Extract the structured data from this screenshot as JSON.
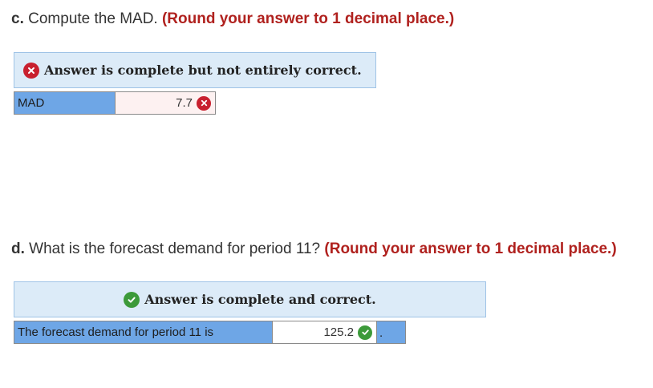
{
  "part_c": {
    "letter": "c.",
    "question": " Compute the MAD. ",
    "instruction": "(Round your answer to 1 decimal place.)",
    "banner": {
      "status": "incorrect",
      "icon": "x-circle-icon",
      "text": "Answer is complete but not entirely correct."
    },
    "answer": {
      "label": "MAD",
      "value": "7.7",
      "result": "incorrect",
      "icon": "x-circle-icon"
    }
  },
  "part_d": {
    "letter": "d.",
    "question": " What is the forecast demand for period 11? ",
    "instruction": "(Round your answer to 1 decimal place.)",
    "banner": {
      "status": "correct",
      "icon": "check-circle-icon",
      "text": "Answer is complete and correct."
    },
    "answer": {
      "label": "The forecast demand for period 11 is",
      "value": "125.2",
      "suffix": ".",
      "result": "correct",
      "icon": "check-circle-icon"
    }
  },
  "colors": {
    "instruction_red": "#b0211e",
    "banner_bg": "#dcebf8",
    "label_blue": "#6ea6e6",
    "incorrect_red": "#c8202f",
    "correct_green": "#3c9a3a"
  }
}
